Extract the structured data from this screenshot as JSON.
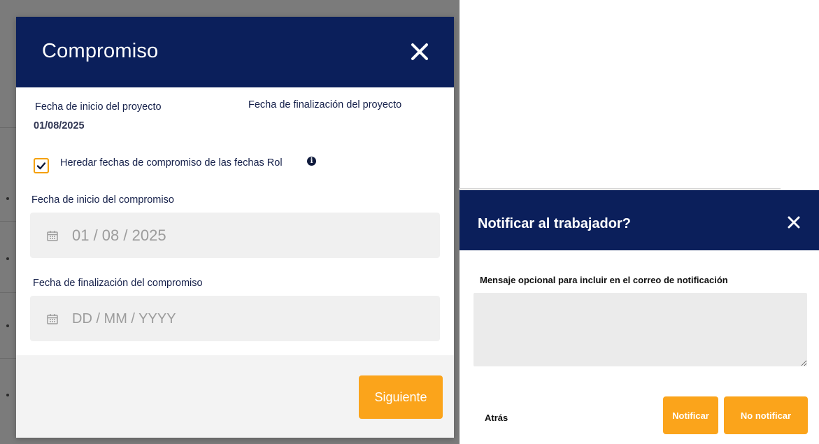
{
  "commitment_modal": {
    "title": "Compromiso",
    "project_start_label": "Fecha de inicio del proyecto",
    "project_start_value": "01/08/2025",
    "project_end_label": "Fecha de finalización del proyecto",
    "inherit_label": "Heredar fechas de compromiso de las fechas Rol",
    "inherit_checked": true,
    "start_label": "Fecha de inicio del compromiso",
    "start_value": "01 / 08 / 2025",
    "end_label": "Fecha de finalización del compromiso",
    "end_placeholder": "DD / MM / YYYY",
    "next_button": "Siguiente"
  },
  "notify_modal": {
    "title": "Notificar al trabajador?",
    "message_label": "Mensaje opcional para incluir en el correo de notificación",
    "message_value": "",
    "back_button": "Atrás",
    "notify_button": "Notificar",
    "no_notify_button": "No notificar"
  },
  "colors": {
    "header": "#0b1f5b",
    "accent": "#fba41b",
    "backdrop": "#7b7b7b"
  }
}
